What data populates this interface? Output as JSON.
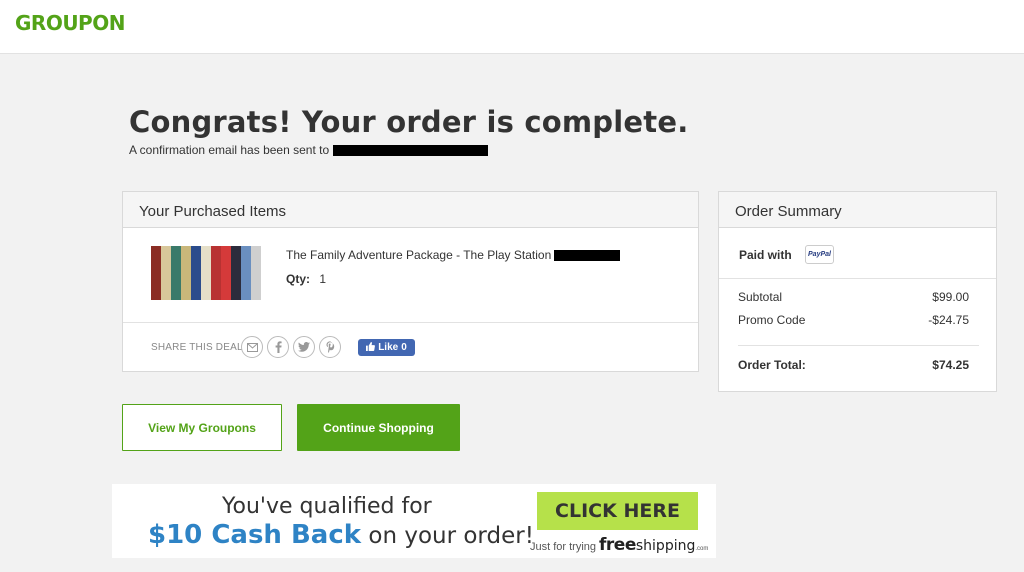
{
  "brand": {
    "logo": "GROUPON",
    "accent": "#53a318"
  },
  "headline": "Congrats! Your order is complete.",
  "confirmation": {
    "text": "A confirmation email has been sent to"
  },
  "items_panel": {
    "title": "Your Purchased Items",
    "item": {
      "title": "The Family Adventure Package - The Play Station",
      "qty_label": "Qty:",
      "qty_value": "1"
    },
    "share": {
      "label": "SHARE THIS DEAL",
      "icons": [
        "email-icon",
        "facebook-icon",
        "twitter-icon",
        "pinterest-icon"
      ],
      "like_label": "Like",
      "like_count": "0"
    }
  },
  "summary_panel": {
    "title": "Order Summary",
    "paid_with_label": "Paid with",
    "payment_method": "PayPal",
    "subtotal_label": "Subtotal",
    "subtotal_value": "$99.00",
    "promo_label": "Promo Code",
    "promo_value": "-$24.75",
    "total_label": "Order Total:",
    "total_value": "$74.25"
  },
  "buttons": {
    "view_groupons": "View My Groupons",
    "continue_shopping": "Continue Shopping"
  },
  "banner": {
    "line1": "You've qualified for",
    "cash": "$10 Cash Back",
    "line2_rest": "on your order!",
    "cta": "CLICK HERE",
    "note_prefix": "Just for trying",
    "note_brand_bold": "free",
    "note_brand_rest": "shipping",
    "note_suffix": ".com"
  }
}
